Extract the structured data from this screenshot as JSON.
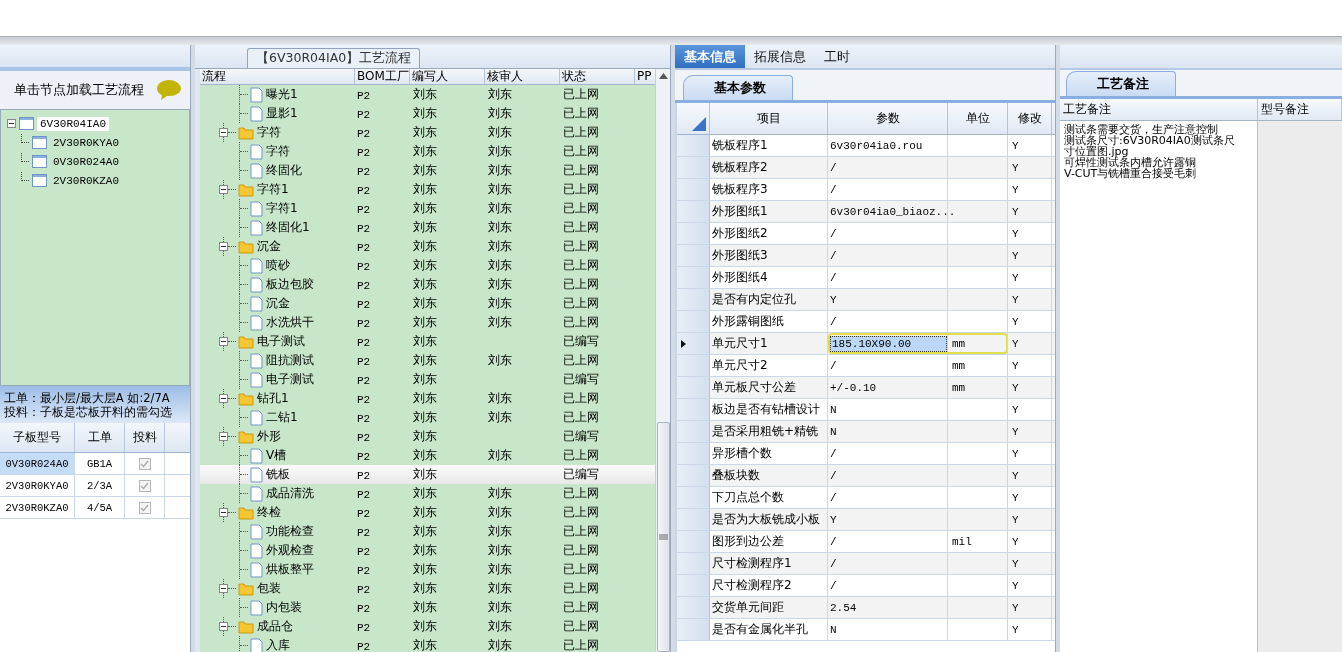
{
  "left_panel": {
    "hint": "单击节点加载工艺流程",
    "tree": {
      "label": "6V30R04IA0",
      "expanded": true,
      "selected": true,
      "children": [
        {
          "label": "2V30R0KYA0"
        },
        {
          "label": "0V30R024A0"
        },
        {
          "label": "2V30R0KZA0"
        }
      ]
    },
    "notes": [
      "工单：最小层/最大层A 如:2/7A",
      "投料：子板是芯板开料的需勾选"
    ],
    "table": {
      "columns": [
        "子板型号",
        "工单",
        "投料"
      ],
      "rows": [
        {
          "model": "0V30R024A0",
          "order": "GB1A",
          "checked": true,
          "selected": true
        },
        {
          "model": "2V30R0KYA0",
          "order": "2/3A",
          "checked": true,
          "selected": false
        },
        {
          "model": "2V30R0KZA0",
          "order": "4/5A",
          "checked": true,
          "selected": false
        }
      ]
    }
  },
  "process": {
    "title": "【6V30R04IA0】工艺流程",
    "columns": [
      "流程",
      "BOM工厂",
      "编写人",
      "核审人",
      "状态",
      "PP"
    ],
    "nodes": [
      {
        "kind": "continued",
        "children": [
          {
            "name": "曝光1",
            "cells": [
              "P2",
              "刘东",
              "刘东",
              "已上网"
            ],
            "selected": false
          },
          {
            "name": "显影1",
            "cells": [
              "P2",
              "刘东",
              "刘东",
              "已上网"
            ],
            "selected": false
          }
        ]
      },
      {
        "kind": "folder",
        "name": "字符",
        "cells": [
          "P2",
          "刘东",
          "刘东",
          "已上网"
        ],
        "expanded": true,
        "selected": false,
        "children": [
          {
            "name": "字符",
            "cells": [
              "P2",
              "刘东",
              "刘东",
              "已上网"
            ],
            "selected": false
          },
          {
            "name": "终固化",
            "cells": [
              "P2",
              "刘东",
              "刘东",
              "已上网"
            ],
            "selected": false
          }
        ]
      },
      {
        "kind": "folder",
        "name": "字符1",
        "cells": [
          "P2",
          "刘东",
          "刘东",
          "已上网"
        ],
        "expanded": true,
        "selected": false,
        "children": [
          {
            "name": "字符1",
            "cells": [
              "P2",
              "刘东",
              "刘东",
              "已上网"
            ],
            "selected": false
          },
          {
            "name": "终固化1",
            "cells": [
              "P2",
              "刘东",
              "刘东",
              "已上网"
            ],
            "selected": false
          }
        ]
      },
      {
        "kind": "folder",
        "name": "沉金",
        "cells": [
          "P2",
          "刘东",
          "刘东",
          "已上网"
        ],
        "expanded": true,
        "selected": false,
        "children": [
          {
            "name": "喷砂",
            "cells": [
              "P2",
              "刘东",
              "刘东",
              "已上网"
            ],
            "selected": false
          },
          {
            "name": "板边包胶",
            "cells": [
              "P2",
              "刘东",
              "刘东",
              "已上网"
            ],
            "selected": false
          },
          {
            "name": "沉金",
            "cells": [
              "P2",
              "刘东",
              "刘东",
              "已上网"
            ],
            "selected": false
          },
          {
            "name": "水洗烘干",
            "cells": [
              "P2",
              "刘东",
              "刘东",
              "已上网"
            ],
            "selected": false
          }
        ]
      },
      {
        "kind": "folder",
        "name": "电子测试",
        "cells": [
          "P2",
          "刘东",
          "",
          "已编写"
        ],
        "expanded": true,
        "selected": false,
        "children": [
          {
            "name": "阻抗测试",
            "cells": [
              "P2",
              "刘东",
              "刘东",
              "已上网"
            ],
            "selected": false
          },
          {
            "name": "电子测试",
            "cells": [
              "P2",
              "刘东",
              "",
              "已编写"
            ],
            "selected": false
          }
        ]
      },
      {
        "kind": "folder",
        "name": "钻孔1",
        "cells": [
          "P2",
          "刘东",
          "刘东",
          "已上网"
        ],
        "expanded": true,
        "selected": false,
        "children": [
          {
            "name": "二钻1",
            "cells": [
              "P2",
              "刘东",
              "刘东",
              "已上网"
            ],
            "selected": false
          }
        ]
      },
      {
        "kind": "folder",
        "name": "外形",
        "cells": [
          "P2",
          "刘东",
          "",
          "已编写"
        ],
        "expanded": true,
        "selected": false,
        "children": [
          {
            "name": "V槽",
            "cells": [
              "P2",
              "刘东",
              "刘东",
              "已上网"
            ],
            "selected": false
          },
          {
            "name": "铣板",
            "cells": [
              "P2",
              "刘东",
              "",
              "已编写"
            ],
            "selected": true
          },
          {
            "name": "成品清洗",
            "cells": [
              "P2",
              "刘东",
              "刘东",
              "已上网"
            ],
            "selected": false
          }
        ]
      },
      {
        "kind": "folder",
        "name": "终检",
        "cells": [
          "P2",
          "刘东",
          "刘东",
          "已上网"
        ],
        "expanded": true,
        "selected": false,
        "children": [
          {
            "name": "功能检查",
            "cells": [
              "P2",
              "刘东",
              "刘东",
              "已上网"
            ],
            "selected": false
          },
          {
            "name": "外观检查",
            "cells": [
              "P2",
              "刘东",
              "刘东",
              "已上网"
            ],
            "selected": false
          },
          {
            "name": "烘板整平",
            "cells": [
              "P2",
              "刘东",
              "刘东",
              "已上网"
            ],
            "selected": false
          }
        ]
      },
      {
        "kind": "folder",
        "name": "包装",
        "cells": [
          "P2",
          "刘东",
          "刘东",
          "已上网"
        ],
        "expanded": true,
        "selected": false,
        "children": [
          {
            "name": "内包装",
            "cells": [
              "P2",
              "刘东",
              "刘东",
              "已上网"
            ],
            "selected": false
          }
        ]
      },
      {
        "kind": "folder",
        "name": "成品仓",
        "cells": [
          "P2",
          "刘东",
          "刘东",
          "已上网"
        ],
        "expanded": true,
        "selected": false,
        "children": [
          {
            "name": "入库",
            "cells": [
              "P2",
              "刘东",
              "刘东",
              "已上网"
            ],
            "selected": false
          }
        ]
      }
    ]
  },
  "detail": {
    "tabs": [
      {
        "label": "基本信息",
        "selected": true
      },
      {
        "label": "拓展信息",
        "selected": false
      },
      {
        "label": "工时",
        "selected": false
      }
    ],
    "subtab": "基本参数",
    "columns": [
      "项目",
      "参数",
      "单位",
      "修改"
    ],
    "rows": [
      {
        "item": "铣板程序1",
        "value": "6v30r04ia0.rou",
        "unit": "",
        "modify": "Y",
        "current": false
      },
      {
        "item": "铣板程序2",
        "value": "/",
        "unit": "",
        "modify": "Y",
        "current": false
      },
      {
        "item": "铣板程序3",
        "value": "/",
        "unit": "",
        "modify": "Y",
        "current": false
      },
      {
        "item": "外形图纸1",
        "value": "6v30r04ia0_biaoz...",
        "unit": "",
        "modify": "Y",
        "current": false
      },
      {
        "item": "外形图纸2",
        "value": "/",
        "unit": "",
        "modify": "Y",
        "current": false
      },
      {
        "item": "外形图纸3",
        "value": "/",
        "unit": "",
        "modify": "Y",
        "current": false
      },
      {
        "item": "外形图纸4",
        "value": "/",
        "unit": "",
        "modify": "Y",
        "current": false
      },
      {
        "item": "是否有内定位孔",
        "value": "Y",
        "unit": "",
        "modify": "Y",
        "current": false
      },
      {
        "item": "外形露铜图纸",
        "value": "/",
        "unit": "",
        "modify": "Y",
        "current": false
      },
      {
        "item": "单元尺寸1",
        "value": "185.10X90.00",
        "unit": "mm",
        "modify": "Y",
        "current": true
      },
      {
        "item": "单元尺寸2",
        "value": "/",
        "unit": "mm",
        "modify": "Y",
        "current": false
      },
      {
        "item": "单元板尺寸公差",
        "value": "+/-0.10",
        "unit": "mm",
        "modify": "Y",
        "current": false
      },
      {
        "item": "板边是否有钻槽设计",
        "value": "N",
        "unit": "",
        "modify": "Y",
        "current": false
      },
      {
        "item": "是否采用粗铣+精铣",
        "value": "N",
        "unit": "",
        "modify": "Y",
        "current": false
      },
      {
        "item": "异形槽个数",
        "value": "/",
        "unit": "",
        "modify": "Y",
        "current": false
      },
      {
        "item": "叠板块数",
        "value": "/",
        "unit": "",
        "modify": "Y",
        "current": false
      },
      {
        "item": "下刀点总个数",
        "value": "/",
        "unit": "",
        "modify": "Y",
        "current": false
      },
      {
        "item": "是否为大板铣成小板",
        "value": "Y",
        "unit": "",
        "modify": "Y",
        "current": false
      },
      {
        "item": "图形到边公差",
        "value": "/",
        "unit": "mil",
        "modify": "Y",
        "current": false
      },
      {
        "item": "尺寸检测程序1",
        "value": "/",
        "unit": "",
        "modify": "Y",
        "current": false
      },
      {
        "item": "尺寸检测程序2",
        "value": "/",
        "unit": "",
        "modify": "Y",
        "current": false
      },
      {
        "item": "交货单元间距",
        "value": "2.54",
        "unit": "",
        "modify": "Y",
        "current": false
      },
      {
        "item": "是否有金属化半孔",
        "value": "N",
        "unit": "",
        "modify": "Y",
        "current": false
      }
    ]
  },
  "remarks": {
    "tab": "工艺备注",
    "columns": [
      "工艺备注",
      "型号备注"
    ],
    "lines": [
      "测试条需要交货，生产注意控制",
      "测试条尺寸:6V30R04IA0测试条尺",
      "寸位置图.jpg",
      "可焊性测试条内槽允许露铜",
      "V-CUT与铣槽重合接受毛刺"
    ]
  }
}
